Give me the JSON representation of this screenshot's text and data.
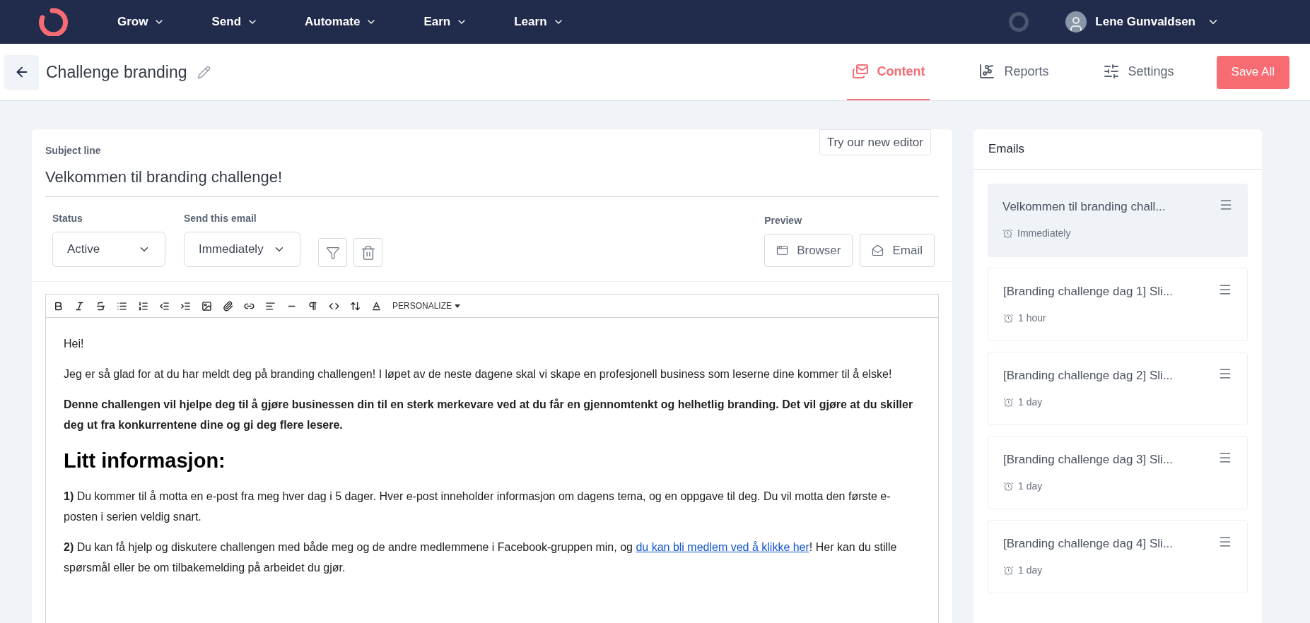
{
  "nav": {
    "menu": [
      {
        "label": "Grow"
      },
      {
        "label": "Send"
      },
      {
        "label": "Automate"
      },
      {
        "label": "Earn"
      },
      {
        "label": "Learn"
      }
    ],
    "user": {
      "name": "Lene Gunvaldsen"
    }
  },
  "header": {
    "title": "Challenge branding",
    "tabs": [
      {
        "label": "Content",
        "selected": true,
        "kind": "content"
      },
      {
        "label": "Reports",
        "selected": false,
        "kind": "reports"
      },
      {
        "label": "Settings",
        "selected": false,
        "kind": "settings"
      }
    ],
    "save_button": "Save All"
  },
  "editor": {
    "try_new_editor": "Try our new editor",
    "subject": {
      "label": "Subject line",
      "value": "Velkommen til branding challenge!"
    },
    "status": {
      "label": "Status",
      "value": "Active"
    },
    "send": {
      "label": "Send this email",
      "value": "Immediately"
    },
    "preview": {
      "label": "Preview",
      "buttons": [
        {
          "label": "Browser",
          "kind": "browser"
        },
        {
          "label": "Email",
          "kind": "email"
        }
      ]
    },
    "toolbar": {
      "personalize": "PERSONALIZE"
    },
    "body": [
      {
        "kind": "p",
        "text": "Hei!"
      },
      {
        "kind": "p",
        "text": "Jeg er så glad for at du har meldt deg på branding challengen! I løpet av de neste dagene skal vi skape en profesjonell business som leserne dine kommer til å elske!"
      },
      {
        "kind": "strong",
        "text": "Denne challengen vil hjelpe deg til å gjøre businessen din til en sterk merkevare ved at du får en gjennomtenkt og helhetlig branding. Det vil gjøre at du skiller deg ut fra konkurrentene dine og gi deg flere lesere."
      },
      {
        "kind": "heading",
        "text": "Litt informasjon:"
      },
      {
        "kind": "p",
        "text": "**1)** Du kommer til å motta en e-post fra meg hver dag i 5 dager. Hver e-post inneholder informasjon om dagens tema, og en oppgave til deg. Du vil motta den første e-posten i serien veldig snart."
      },
      {
        "kind": "p",
        "text": "**2)** Du kan få hjelp og diskutere challengen med både meg og de andre medlemmene i Facebook-gruppen min, og ",
        "link": "du kan bli medlem ved å klikke her",
        "after": "! Her kan du stille spørsmål eller be om tilbakemelding på arbeidet du gjør."
      }
    ]
  },
  "emails": {
    "title": "Emails",
    "items": [
      {
        "title": "Velkommen til branding chall...",
        "delay": "Immediately",
        "selected": true
      },
      {
        "title": "[Branding challenge dag 1] Sli...",
        "delay": "1 hour",
        "selected": false
      },
      {
        "title": "[Branding challenge dag 2] Sli...",
        "delay": "1 day",
        "selected": false
      },
      {
        "title": "[Branding challenge dag 3] Sli...",
        "delay": "1 day",
        "selected": false
      },
      {
        "title": "[Branding challenge dag 4] Sli...",
        "delay": "1 day",
        "selected": false
      }
    ]
  }
}
